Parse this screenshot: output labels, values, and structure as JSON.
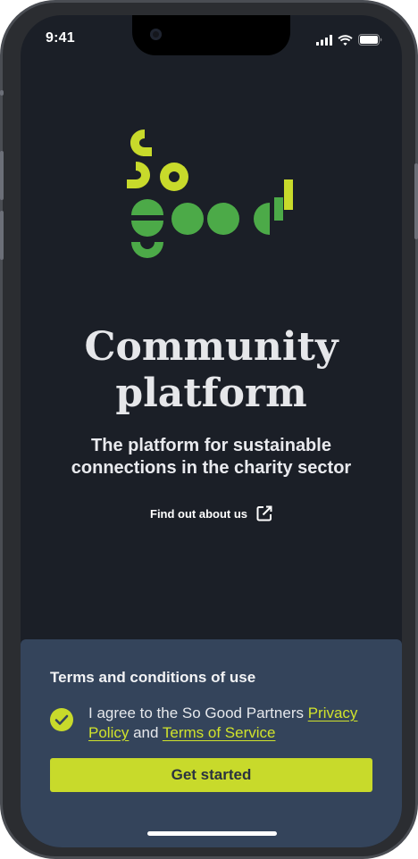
{
  "status_bar": {
    "time": "9:41",
    "icons": [
      "cellular-signal-icon",
      "wifi-icon",
      "battery-icon"
    ]
  },
  "brand": {
    "logo_text": "So good",
    "colors": {
      "lime": "#c8da2b",
      "green": "#4caa48",
      "background": "#1b1f27",
      "panel": "#34445b"
    }
  },
  "hero": {
    "title_line1": "Community",
    "title_line2": "platform",
    "subtitle_line1": "The platform for sustainable",
    "subtitle_line2": "connections in the charity sector",
    "find_out_link": "Find out about us",
    "find_out_icon": "external-link-icon"
  },
  "terms": {
    "title": "Terms and conditions of use",
    "checked": true,
    "agree_prefix": "I agree to the So Good Partners ",
    "privacy_link": "Privacy Policy",
    "agree_and": " and ",
    "terms_link": "Terms of Service",
    "button_label": "Get started"
  }
}
